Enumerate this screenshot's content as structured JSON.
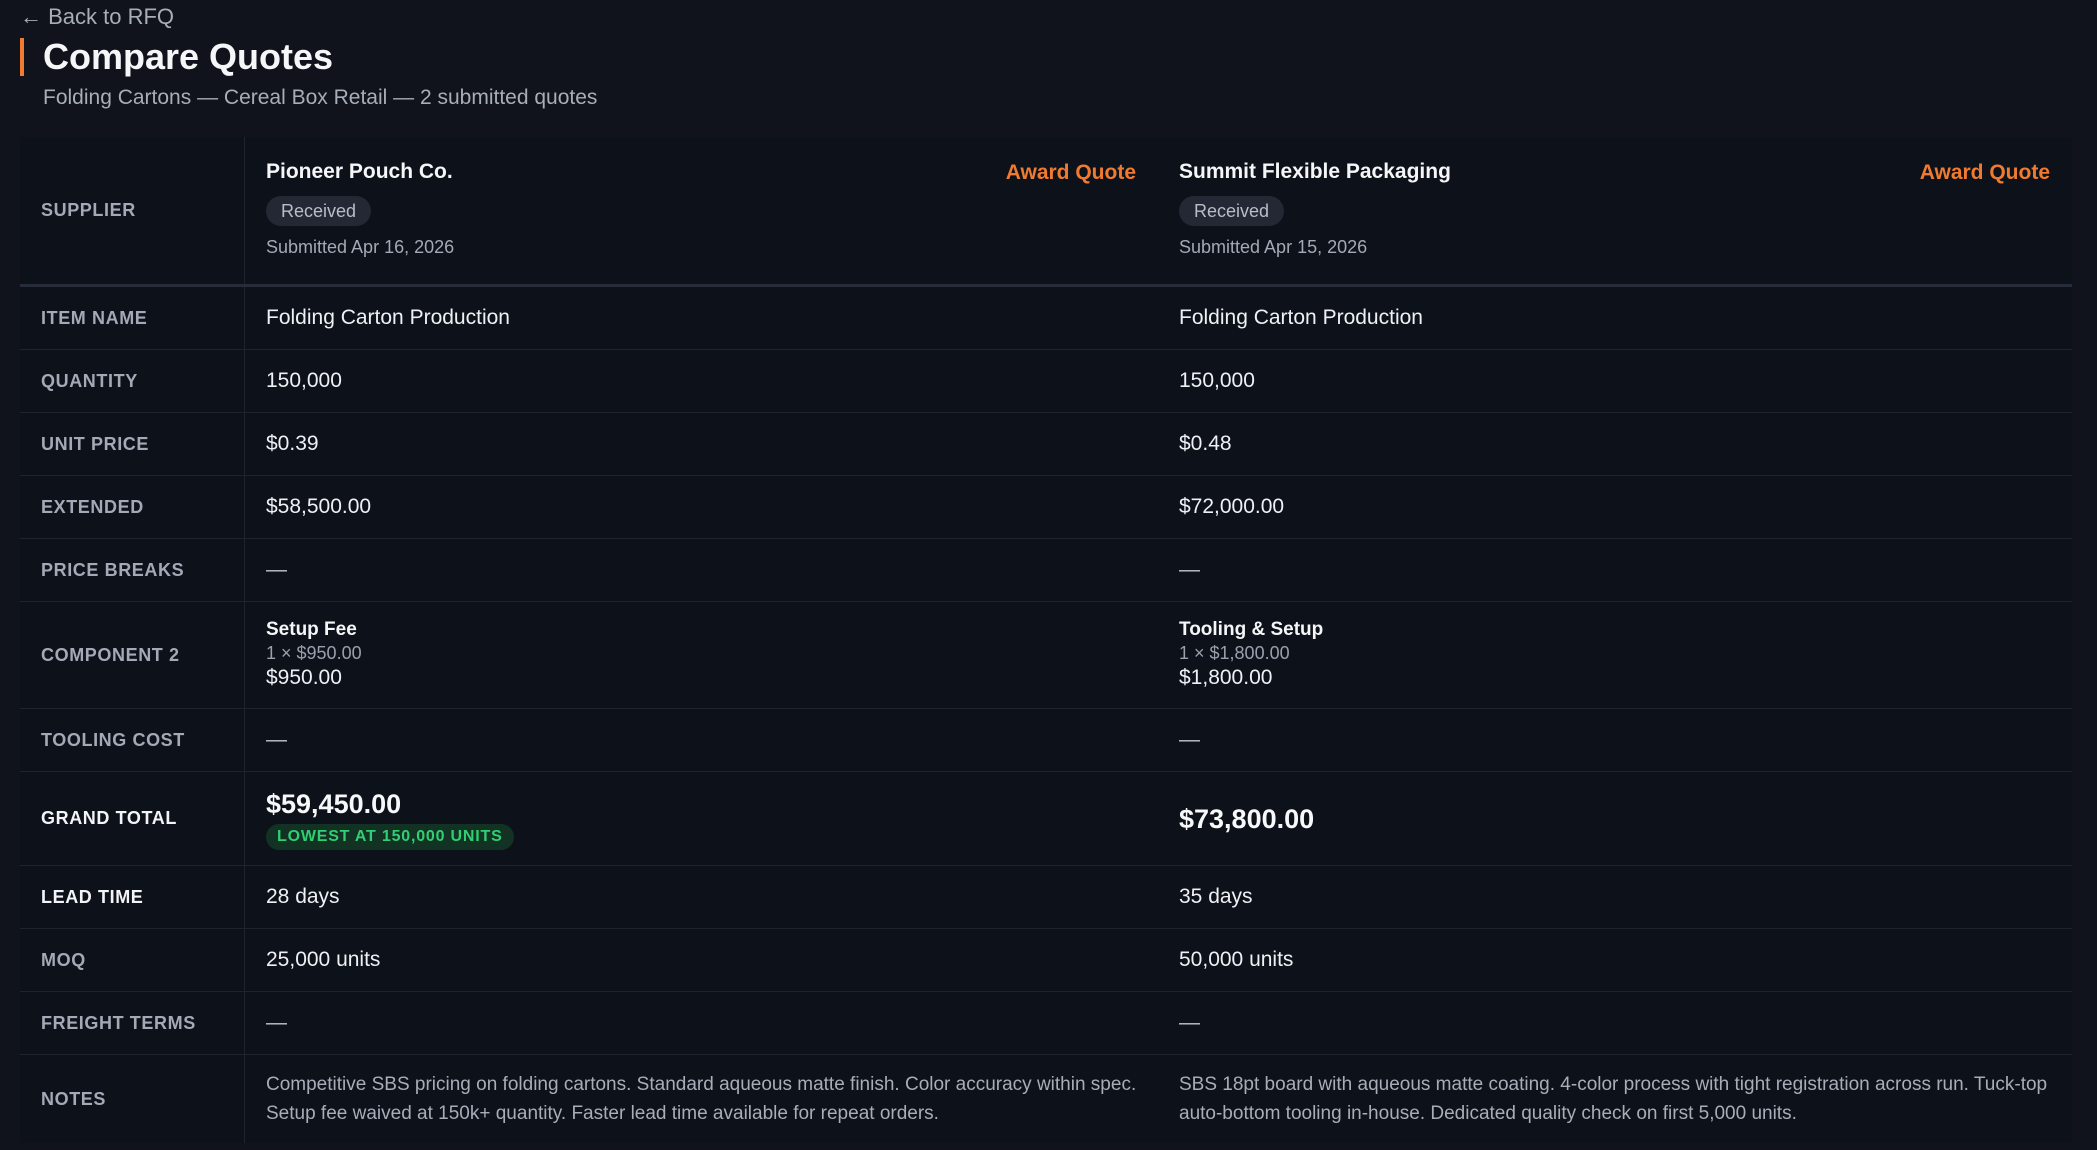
{
  "nav": {
    "back_label": "← Back to RFQ"
  },
  "header": {
    "title": "Compare Quotes",
    "subtitle": "Folding Cartons — Cereal Box Retail — 2 submitted quotes"
  },
  "colors": {
    "accent": "#f07a2f",
    "success": "#2fcf72",
    "background": "#10131b"
  },
  "labels": {
    "supplier": "Supplier",
    "item_name": "Item Name",
    "quantity": "Quantity",
    "unit_price": "Unit Price",
    "extended": "Extended",
    "price_breaks": "Price Breaks",
    "component_2": "Component 2",
    "tooling_cost": "Tooling Cost",
    "grand_total": "Grand Total",
    "lead_time": "Lead Time",
    "moq": "MOQ",
    "freight_terms": "Freight Terms",
    "notes": "Notes"
  },
  "quotes": [
    {
      "supplier": "Pioneer Pouch Co.",
      "award_label": "Award Quote",
      "status": "Received",
      "submitted": "Submitted Apr 16, 2026",
      "item_name": "Folding Carton Production",
      "quantity": "150,000",
      "unit_price": "$0.39",
      "extended": "$58,500.00",
      "price_breaks": "—",
      "component": {
        "name": "Setup Fee",
        "qty": "1 × $950.00",
        "total": "$950.00"
      },
      "tooling_cost": "—",
      "grand_total": "$59,450.00",
      "grand_badge": "LOWEST AT 150,000 UNITS",
      "lead_time": "28 days",
      "moq": "25,000 units",
      "freight_terms": "—",
      "notes": "Competitive SBS pricing on folding cartons. Standard aqueous matte finish. Color accuracy within spec. Setup fee waived at 150k+ quantity. Faster lead time available for repeat orders."
    },
    {
      "supplier": "Summit Flexible Packaging",
      "award_label": "Award Quote",
      "status": "Received",
      "submitted": "Submitted Apr 15, 2026",
      "item_name": "Folding Carton Production",
      "quantity": "150,000",
      "unit_price": "$0.48",
      "extended": "$72,000.00",
      "price_breaks": "—",
      "component": {
        "name": "Tooling & Setup",
        "qty": "1 × $1,800.00",
        "total": "$1,800.00"
      },
      "tooling_cost": "—",
      "grand_total": "$73,800.00",
      "lead_time": "35 days",
      "moq": "50,000 units",
      "freight_terms": "—",
      "notes": "SBS 18pt board with aqueous matte coating. 4-color process with tight registration across run. Tuck-top auto-bottom tooling in-house. Dedicated quality check on first 5,000 units."
    }
  ]
}
